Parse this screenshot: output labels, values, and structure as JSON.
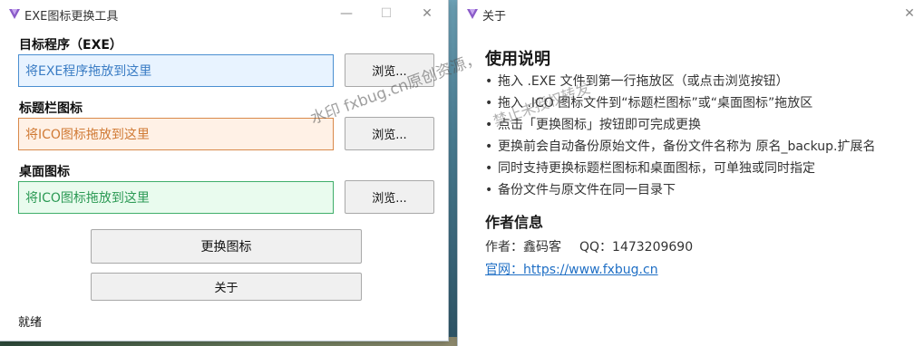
{
  "main_window": {
    "title": "EXE图标更换工具",
    "title_controls": {
      "minimize": "—",
      "maximize": "☐",
      "close": "✕"
    },
    "exe_section": {
      "label": "目标程序（EXE）",
      "drop_text": "将EXE程序拖放到这里",
      "browse_label": "浏览..."
    },
    "titlebar_icon_section": {
      "label": "标题栏图标",
      "drop_text": "将ICO图标拖放到这里",
      "browse_label": "浏览..."
    },
    "desktop_icon_section": {
      "label": "桌面图标",
      "drop_text": "将ICO图标拖放到这里",
      "browse_label": "浏览..."
    },
    "replace_button": "更换图标",
    "about_button": "关于",
    "status": "就绪"
  },
  "about_window": {
    "title": "关于",
    "close": "✕",
    "usage_heading": "使用说明",
    "usage_items": [
      "拖入 .EXE 文件到第一行拖放区（或点击浏览按钮）",
      "拖入 .ICO 图标文件到“标题栏图标”或“桌面图标”拖放区",
      "点击「更换图标」按钮即可完成更换",
      "更换前会自动备份原始文件，备份文件名称为 原名_backup.扩展名",
      "同时支持更换标题栏图标和桌面图标，可单独或同时指定",
      "备份文件与原文件在同一目录下"
    ],
    "bullet": "•",
    "author_heading": "作者信息",
    "author": "作者：鑫码客",
    "qq": "QQ：1473209690",
    "website": "官网：https://www.fxbug.cn"
  },
  "watermark": {
    "line1": "水印 fxbug.cn原创资源，",
    "line2": "禁止未授权转发"
  },
  "colors": {
    "exe_drop_border": "#4a8fd1",
    "titlebar_drop_border": "#d9894a",
    "desktop_drop_border": "#3fae6a",
    "link": "#1f6fc5",
    "app_icon": "#8b5cc9"
  }
}
